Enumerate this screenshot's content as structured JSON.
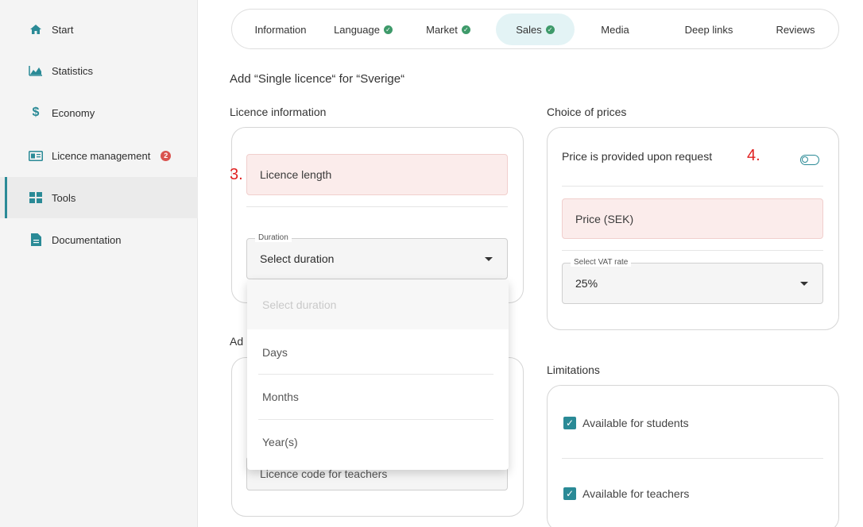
{
  "sidebar": {
    "items": [
      {
        "label": "Start",
        "icon": "home-icon"
      },
      {
        "label": "Statistics",
        "icon": "chart-icon"
      },
      {
        "label": "Economy",
        "icon": "dollar-icon"
      },
      {
        "label": "Licence management",
        "icon": "id-card-icon",
        "badge": "2"
      },
      {
        "label": "Tools",
        "icon": "grid-icon"
      },
      {
        "label": "Documentation",
        "icon": "document-icon"
      }
    ],
    "accent": "#2a8a96",
    "badge_color": "#d9534f"
  },
  "tabs": [
    {
      "label": "Information"
    },
    {
      "label": "Language",
      "done": true
    },
    {
      "label": "Market",
      "done": true
    },
    {
      "label": "Sales",
      "done": true,
      "active": true
    },
    {
      "label": "Media"
    },
    {
      "label": "Deep links"
    },
    {
      "label": "Reviews"
    }
  ],
  "page": {
    "title": "Add “Single licence“ for “Sverige“"
  },
  "licence_info": {
    "section_label": "Licence information",
    "licence_length": "Licence length",
    "duration_label": "Duration",
    "duration_value": "Select duration",
    "dropdown": {
      "placeholder": "Select duration",
      "options": [
        "Days",
        "Months",
        "Year(s)"
      ]
    }
  },
  "partial": {
    "section_label_fragment": "Ad",
    "teachers_code_fragment": "Licence code for teachers"
  },
  "prices": {
    "section_label": "Choice of prices",
    "on_request_label": "Price is provided upon request",
    "on_request_enabled": false,
    "price_field": "Price (SEK)",
    "vat_label": "Select VAT rate",
    "vat_value": "25%"
  },
  "limitations": {
    "section_label": "Limitations",
    "students": {
      "label": "Available for students",
      "checked": true
    },
    "teachers": {
      "label": "Available for teachers",
      "checked": true
    }
  },
  "annotations": {
    "step3": "3.",
    "step4": "4."
  },
  "colors": {
    "error_field_bg": "#fbeceb",
    "active_tab_bg": "#e3f3f5",
    "check_green": "#3e9a6a",
    "annotation_red": "#e02020"
  }
}
